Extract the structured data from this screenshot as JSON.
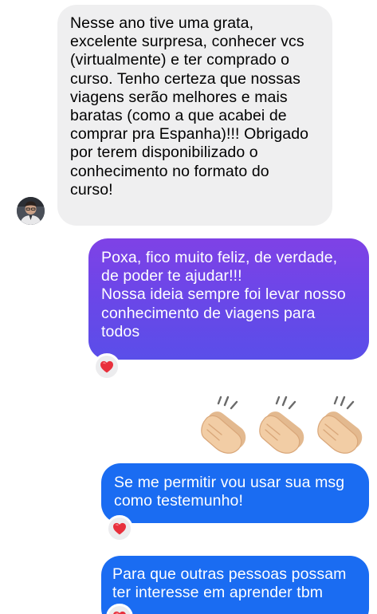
{
  "conversation": {
    "incoming": {
      "lines": [
        "Nesse ano tive uma grata,",
        "excelente surpresa, conhecer vcs",
        "(virtualmente) e ter comprado o",
        "curso. Tenho certeza que nossas",
        "viagens serão melhores e mais",
        "baratas (como a que acabei de",
        "comprar pra Espanha)!!! Obrigado",
        "por terem disponibilizado o",
        "conhecimento no formato do",
        "curso!"
      ]
    },
    "outgoing_1": {
      "lines": [
        "Poxa, fico muito feliz, de verdade,",
        "de poder te ajudar!!!",
        "Nossa ideia sempre foi levar nosso",
        "conhecimento de viagens para",
        "todos"
      ],
      "reaction": "heart"
    },
    "emoji_message": {
      "emojis": [
        "clapping-hands",
        "clapping-hands",
        "clapping-hands"
      ]
    },
    "outgoing_2": {
      "lines": [
        "Se me permitir vou usar sua msg",
        "como testemunho!"
      ],
      "reaction": "heart"
    },
    "outgoing_3": {
      "lines": [
        "Para que outras pessoas possam",
        "ter interesse em aprender tbm"
      ],
      "reaction": "heart"
    }
  },
  "colors": {
    "incoming_bubble": "#efeff0",
    "outgoing_gradient_top": "#7f42e6",
    "outgoing_gradient_bottom": "#5a4ee9",
    "outgoing_blue": "#1a6cf2",
    "heart": "#e8303c"
  }
}
